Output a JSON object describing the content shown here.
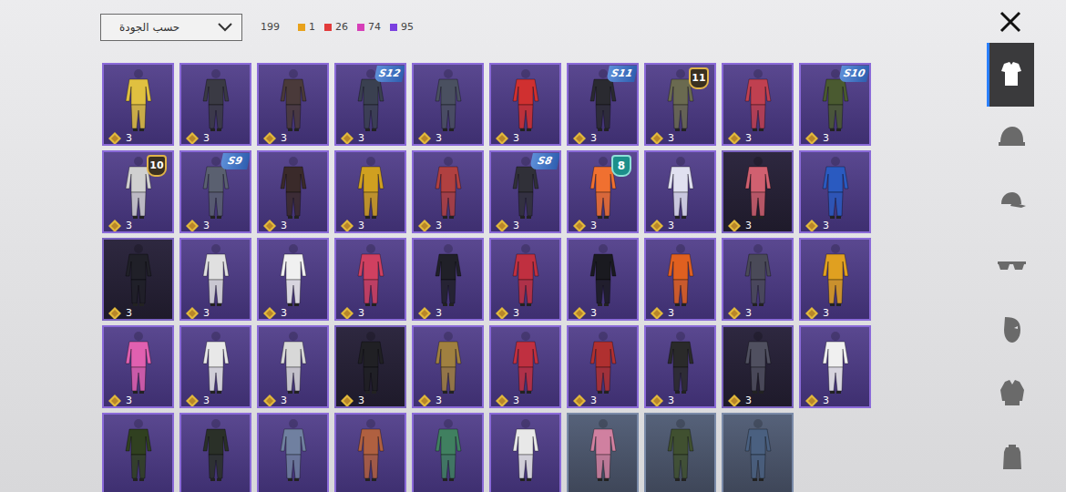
{
  "sort_dropdown": {
    "label": "حسب الجودة"
  },
  "total": "199",
  "quality_counts": [
    {
      "count": "1",
      "color": "#e8a21c"
    },
    {
      "count": "26",
      "color": "#e23b3b"
    },
    {
      "count": "74",
      "color": "#d63fb8"
    },
    {
      "count": "95",
      "color": "#7a3fe0"
    }
  ],
  "categories": [
    {
      "kind": "outfit",
      "selected": true
    },
    {
      "kind": "helmet",
      "selected": false
    },
    {
      "kind": "cap",
      "selected": false
    },
    {
      "kind": "glasses",
      "selected": false
    },
    {
      "kind": "mask",
      "selected": false
    },
    {
      "kind": "jacket",
      "selected": false
    },
    {
      "kind": "backpack",
      "selected": false
    }
  ],
  "items": [
    {
      "kind": "normal",
      "color": "#e0c040",
      "price": "3",
      "badge": null
    },
    {
      "kind": "normal",
      "color": "#3a3a44",
      "price": "3",
      "badge": null
    },
    {
      "kind": "normal",
      "color": "#4a3a3a",
      "price": "3",
      "badge": null
    },
    {
      "kind": "normal",
      "color": "#3a4050",
      "price": "3",
      "badge": {
        "text": "S12",
        "kind": "season"
      }
    },
    {
      "kind": "normal",
      "color": "#4a5060",
      "price": "3",
      "badge": null
    },
    {
      "kind": "normal",
      "color": "#d03030",
      "price": "3",
      "badge": null
    },
    {
      "kind": "normal",
      "color": "#2a2a30",
      "price": "3",
      "badge": {
        "text": "S11",
        "kind": "season"
      }
    },
    {
      "kind": "normal",
      "color": "#6a6a50",
      "price": "3",
      "badge": {
        "text": "11",
        "kind": "rank-gold"
      }
    },
    {
      "kind": "normal",
      "color": "#c04050",
      "price": "3",
      "badge": null
    },
    {
      "kind": "normal",
      "color": "#4a5a30",
      "price": "3",
      "badge": {
        "text": "S10",
        "kind": "season"
      }
    },
    {
      "kind": "normal",
      "color": "#d0d0d0",
      "price": "3",
      "badge": {
        "text": "10",
        "kind": "rank-gold"
      }
    },
    {
      "kind": "normal",
      "color": "#5a6070",
      "price": "3",
      "badge": {
        "text": "S9",
        "kind": "season"
      }
    },
    {
      "kind": "normal",
      "color": "#3a2a2a",
      "price": "3",
      "badge": null
    },
    {
      "kind": "normal",
      "color": "#d0a020",
      "price": "3",
      "badge": null
    },
    {
      "kind": "normal",
      "color": "#b04040",
      "price": "3",
      "badge": null
    },
    {
      "kind": "normal",
      "color": "#303038",
      "price": "3",
      "badge": {
        "text": "S8",
        "kind": "season"
      }
    },
    {
      "kind": "normal",
      "color": "#f07030",
      "price": "3",
      "badge": {
        "text": "8",
        "kind": "rank-teal"
      }
    },
    {
      "kind": "normal",
      "color": "#e0e0f0",
      "price": "3",
      "badge": null
    },
    {
      "kind": "dark",
      "color": "#d06070",
      "price": "3",
      "badge": null
    },
    {
      "kind": "normal",
      "color": "#2a5ac0",
      "price": "3",
      "badge": null
    },
    {
      "kind": "dark",
      "color": "#202028",
      "price": "3",
      "badge": null
    },
    {
      "kind": "normal",
      "color": "#e0e0e0",
      "price": "3",
      "badge": null
    },
    {
      "kind": "normal",
      "color": "#f0f0f0",
      "price": "3",
      "badge": null
    },
    {
      "kind": "normal",
      "color": "#d04060",
      "price": "3",
      "badge": null
    },
    {
      "kind": "normal",
      "color": "#202028",
      "price": "3",
      "badge": null
    },
    {
      "kind": "normal",
      "color": "#c03040",
      "price": "3",
      "badge": null
    },
    {
      "kind": "normal",
      "color": "#1a1a20",
      "price": "3",
      "badge": null
    },
    {
      "kind": "normal",
      "color": "#e06020",
      "price": "3",
      "badge": null
    },
    {
      "kind": "normal",
      "color": "#4a4a58",
      "price": "3",
      "badge": null
    },
    {
      "kind": "normal",
      "color": "#e0a020",
      "price": "3",
      "badge": null
    },
    {
      "kind": "normal",
      "color": "#e060b0",
      "price": "3",
      "badge": null
    },
    {
      "kind": "normal",
      "color": "#e8e8e8",
      "price": "3",
      "badge": null
    },
    {
      "kind": "normal",
      "color": "#d8d8d8",
      "price": "3",
      "badge": null
    },
    {
      "kind": "dark",
      "color": "#202024",
      "price": "3",
      "badge": null
    },
    {
      "kind": "normal",
      "color": "#a08040",
      "price": "3",
      "badge": null
    },
    {
      "kind": "normal",
      "color": "#c03040",
      "price": "3",
      "badge": null
    },
    {
      "kind": "normal",
      "color": "#b03030",
      "price": "3",
      "badge": null
    },
    {
      "kind": "normal",
      "color": "#2a2a2a",
      "price": "3",
      "badge": null
    },
    {
      "kind": "dark",
      "color": "#505060",
      "price": "3",
      "badge": null
    },
    {
      "kind": "normal",
      "color": "#f0f0f0",
      "price": "3",
      "badge": null
    },
    {
      "kind": "normal",
      "color": "#304020",
      "price": null,
      "badge": null
    },
    {
      "kind": "normal",
      "color": "#2a3028",
      "price": null,
      "badge": null
    },
    {
      "kind": "normal",
      "color": "#7080a0",
      "price": null,
      "badge": null
    },
    {
      "kind": "normal",
      "color": "#b06040",
      "price": null,
      "badge": null
    },
    {
      "kind": "normal",
      "color": "#408060",
      "price": null,
      "badge": null
    },
    {
      "kind": "normal",
      "color": "#e8e8e8",
      "price": null,
      "badge": null
    },
    {
      "kind": "grey",
      "color": "#d080a0",
      "price": null,
      "badge": null
    },
    {
      "kind": "grey",
      "color": "#405030",
      "price": null,
      "badge": null
    },
    {
      "kind": "grey",
      "color": "#4a6080",
      "price": null,
      "badge": null
    }
  ]
}
